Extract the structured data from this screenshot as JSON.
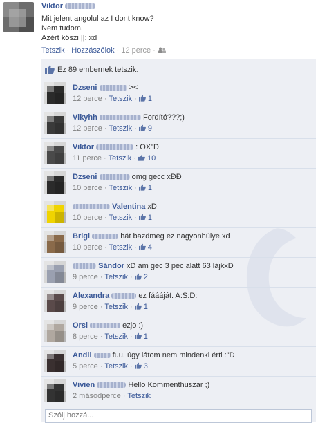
{
  "post": {
    "author": "Viktor",
    "lines": [
      "Mit jelent angolul az I dont know?",
      "Nem tudom.",
      "Azért köszi ||: xd"
    ],
    "actions": {
      "like": "Tetszik",
      "comment": "Hozzászólok",
      "time": "12 perce"
    }
  },
  "likes_summary": "Ez 89 embernek tetszik.",
  "comments": [
    {
      "name": "Dzseni",
      "text": "><",
      "time": "12 perce",
      "like": "Tetszik",
      "likes": "1",
      "avatar": "#2b2b2b"
    },
    {
      "name": "Vikyhh",
      "text": "Fordító???;)",
      "time": "12 perce",
      "like": "Tetszik",
      "likes": "9",
      "avatar": "#3a3a3a"
    },
    {
      "name": "Viktor",
      "text": ": OX\"D",
      "time": "11 perce",
      "like": "Tetszik",
      "likes": "10",
      "avatar": "#4a4a4a"
    },
    {
      "name": "Dzseni",
      "text": "omg gecc xÐÐ",
      "time": "10 perce",
      "like": "Tetszik",
      "likes": "1",
      "avatar": "#2b2b2b"
    },
    {
      "name": "Valentina",
      "text": "xD",
      "time": "10 perce",
      "like": "Tetszik",
      "likes": "1",
      "avatar": "#f0d400",
      "prefix_blur": true
    },
    {
      "name": "Brigi",
      "text": "hát bazdmeg ez nagyonhülye.xd",
      "time": "10 perce",
      "like": "Tetszik",
      "likes": "4",
      "avatar": "#8a6a4a"
    },
    {
      "name": "Sándor",
      "text": "xD am gec 3 pec alatt 63 lájkxD",
      "time": "9 perce",
      "like": "Tetszik",
      "likes": "2",
      "avatar": "#9aa0b0",
      "prefix_blur": true
    },
    {
      "name": "Alexandra",
      "text": "ez fáááját. A:S:D:",
      "time": "9 perce",
      "like": "Tetszik",
      "likes": "1",
      "avatar": "#5a4a4a"
    },
    {
      "name": "Orsi",
      "text": "ezjo :)",
      "time": "8 perce",
      "like": "Tetszik",
      "likes": "1",
      "avatar": "#b0a8a0"
    },
    {
      "name": "Andii",
      "text": "fuu. úgy látom nem mindenki érti :\"D",
      "time": "5 perce",
      "like": "Tetszik",
      "likes": "3",
      "avatar": "#3a3030"
    },
    {
      "name": "Vivien",
      "text": "Hello Kommenthuszár ;)",
      "time": "2 másodperce",
      "like": "Tetszik",
      "likes": "",
      "avatar": "#333333"
    }
  ],
  "reply_placeholder": "Szólj hozzá...",
  "colors": {
    "link": "#3b5998",
    "feedback_bg": "#edeff4",
    "divider": "#d8dfea"
  }
}
